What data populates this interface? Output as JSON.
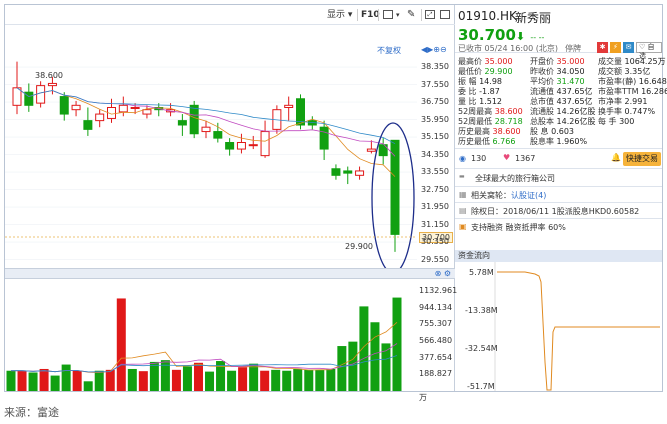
{
  "toolbar": {
    "display_label": "显示",
    "f10_label": "F10",
    "restore_label": "不复权"
  },
  "stock": {
    "code": "01910.HK",
    "name": "新秀丽",
    "price": "30.700",
    "arrow": "⬇",
    "change": "-- --",
    "status": "已收市 05/24 16:00 (北京)",
    "halt": "停牌",
    "watch_label": "自选"
  },
  "quote": {
    "rows": [
      [
        {
          "k": "最高价",
          "v": "35.000",
          "c": "red"
        },
        {
          "k": "开盘价",
          "v": "35.000",
          "c": "red"
        },
        {
          "k": "成交量",
          "v": "1064.25万",
          "c": "blk"
        }
      ],
      [
        {
          "k": "最低价",
          "v": "29.900",
          "c": "green"
        },
        {
          "k": "昨收价",
          "v": "34.050",
          "c": "blk"
        },
        {
          "k": "成交额",
          "v": "3.35亿",
          "c": "blk"
        }
      ],
      [
        {
          "k": "振 幅",
          "v": "14.98",
          "c": "blk"
        },
        {
          "k": "平均价",
          "v": "31.470",
          "c": "green"
        },
        {
          "k": "市盈率(静)",
          "v": "16.648",
          "c": "blk"
        }
      ],
      [
        {
          "k": "委 比",
          "v": "-1.87",
          "c": "blk"
        },
        {
          "k": "流通值",
          "v": "437.65亿",
          "c": "blk"
        },
        {
          "k": "市盈率TTM",
          "v": "16.286",
          "c": "blk"
        }
      ],
      [
        {
          "k": "量 比",
          "v": "1.512",
          "c": "blk"
        },
        {
          "k": "总市值",
          "v": "437.65亿",
          "c": "blk"
        },
        {
          "k": "市净率",
          "v": "2.991",
          "c": "blk"
        }
      ],
      [
        {
          "k": "52周最高",
          "v": "38.600",
          "c": "red"
        },
        {
          "k": "流通股",
          "v": "14.26亿股",
          "c": "blk"
        },
        {
          "k": "换手率",
          "v": "0.747%",
          "c": "blk"
        }
      ],
      [
        {
          "k": "52周最低",
          "v": "28.718",
          "c": "green"
        },
        {
          "k": "总股本",
          "v": "14.26亿股",
          "c": "blk"
        },
        {
          "k": "每 手",
          "v": "300",
          "c": "blk"
        }
      ],
      [
        {
          "k": "历史最高",
          "v": "38.600",
          "c": "red"
        },
        {
          "k": "股 息",
          "v": "0.603",
          "c": "blk"
        },
        {
          "k": "",
          "v": "",
          "c": "blk"
        }
      ],
      [
        {
          "k": "历史最低",
          "v": "6.766",
          "c": "green"
        },
        {
          "k": "股息率",
          "v": "1.960%",
          "c": "blk"
        },
        {
          "k": "",
          "v": "",
          "c": "blk"
        }
      ]
    ]
  },
  "social": {
    "views": "130",
    "likes": "1367",
    "trade_button": "快捷交易"
  },
  "info": {
    "company": "全球最大的旅行箱公司",
    "warrants": "相关窝轮：",
    "warrants_link": "认股证(4)",
    "dividend": "除权日：2018/06/11 1股派股息HKD0.60582",
    "margin": "支持融资 融资抵押率 60%"
  },
  "flow": {
    "title": "资金流向",
    "labels": [
      "5.78M",
      "-13.38M",
      "-32.54M",
      "-51.7M"
    ]
  },
  "axis": {
    "price_labels": [
      "38.350",
      "37.550",
      "36.750",
      "35.950",
      "35.150",
      "34.350",
      "33.550",
      "32.750",
      "31.950",
      "31.150",
      "30.350",
      "29.550"
    ],
    "vol_labels": [
      "1132.961",
      "944.134",
      "755.307",
      "566.480",
      "377.654",
      "188.827",
      "万"
    ],
    "high_label": "38.600",
    "low_label": "29.900",
    "current_label": "30.700"
  },
  "candles": [
    {
      "o": 36.6,
      "c": 37.4,
      "h": 38.6,
      "l": 36.2
    },
    {
      "o": 37.2,
      "c": 36.6,
      "h": 37.6,
      "l": 36.3
    },
    {
      "o": 36.7,
      "c": 37.5,
      "h": 37.7,
      "l": 36.5
    },
    {
      "o": 37.5,
      "c": 37.6,
      "h": 37.9,
      "l": 37.1
    },
    {
      "o": 37.0,
      "c": 36.2,
      "h": 37.2,
      "l": 35.9
    },
    {
      "o": 36.4,
      "c": 36.6,
      "h": 36.8,
      "l": 36.1
    },
    {
      "o": 35.9,
      "c": 35.5,
      "h": 36.5,
      "l": 35.2
    },
    {
      "o": 35.9,
      "c": 36.2,
      "h": 36.4,
      "l": 35.6
    },
    {
      "o": 36.0,
      "c": 36.5,
      "h": 36.9,
      "l": 35.8
    },
    {
      "o": 36.3,
      "c": 36.6,
      "h": 37.0,
      "l": 36.1
    },
    {
      "o": 36.5,
      "c": 36.5,
      "h": 36.7,
      "l": 36.2
    },
    {
      "o": 36.2,
      "c": 36.4,
      "h": 36.6,
      "l": 36.0
    },
    {
      "o": 36.5,
      "c": 36.4,
      "h": 36.7,
      "l": 36.1
    },
    {
      "o": 36.3,
      "c": 36.4,
      "h": 36.7,
      "l": 36.1
    },
    {
      "o": 35.9,
      "c": 35.7,
      "h": 36.2,
      "l": 35.2
    },
    {
      "o": 36.6,
      "c": 35.3,
      "h": 36.8,
      "l": 35.1
    },
    {
      "o": 35.4,
      "c": 35.6,
      "h": 35.9,
      "l": 35.1
    },
    {
      "o": 35.4,
      "c": 35.1,
      "h": 35.8,
      "l": 34.9
    },
    {
      "o": 34.9,
      "c": 34.6,
      "h": 35.1,
      "l": 34.3
    },
    {
      "o": 34.6,
      "c": 34.9,
      "h": 35.3,
      "l": 34.4
    },
    {
      "o": 34.8,
      "c": 34.8,
      "h": 35.2,
      "l": 34.6
    },
    {
      "o": 34.3,
      "c": 35.4,
      "h": 35.9,
      "l": 34.2
    },
    {
      "o": 35.5,
      "c": 36.4,
      "h": 36.6,
      "l": 35.3
    },
    {
      "o": 36.5,
      "c": 36.6,
      "h": 37.0,
      "l": 35.9
    },
    {
      "o": 36.9,
      "c": 35.7,
      "h": 37.1,
      "l": 35.5
    },
    {
      "o": 35.9,
      "c": 35.7,
      "h": 36.1,
      "l": 35.5
    },
    {
      "o": 35.6,
      "c": 34.6,
      "h": 35.9,
      "l": 34.1
    },
    {
      "o": 33.7,
      "c": 33.4,
      "h": 33.9,
      "l": 33.2
    },
    {
      "o": 33.6,
      "c": 33.5,
      "h": 33.8,
      "l": 33.0
    },
    {
      "o": 33.4,
      "c": 33.6,
      "h": 33.8,
      "l": 33.2
    },
    {
      "o": 34.5,
      "c": 34.6,
      "h": 35.0,
      "l": 34.4
    },
    {
      "o": 34.8,
      "c": 34.3,
      "h": 35.1,
      "l": 33.9
    },
    {
      "o": 35.0,
      "c": 30.7,
      "h": 35.0,
      "l": 29.9
    }
  ],
  "volumes": [
    {
      "v": 230,
      "up": false
    },
    {
      "v": 230,
      "up": true
    },
    {
      "v": 210,
      "up": false
    },
    {
      "v": 250,
      "up": true
    },
    {
      "v": 175,
      "up": false
    },
    {
      "v": 300,
      "up": false
    },
    {
      "v": 230,
      "up": true
    },
    {
      "v": 110,
      "up": false
    },
    {
      "v": 230,
      "up": false
    },
    {
      "v": 240,
      "up": true
    },
    {
      "v": 1050,
      "up": true
    },
    {
      "v": 250,
      "up": false
    },
    {
      "v": 225,
      "up": true
    },
    {
      "v": 330,
      "up": false
    },
    {
      "v": 350,
      "up": false
    },
    {
      "v": 240,
      "up": true
    },
    {
      "v": 280,
      "up": false
    },
    {
      "v": 320,
      "up": true
    },
    {
      "v": 220,
      "up": false
    },
    {
      "v": 340,
      "up": false
    },
    {
      "v": 230,
      "up": false
    },
    {
      "v": 270,
      "up": true
    },
    {
      "v": 310,
      "up": false
    },
    {
      "v": 230,
      "up": true
    },
    {
      "v": 240,
      "up": false
    },
    {
      "v": 230,
      "up": false
    },
    {
      "v": 250,
      "up": false
    },
    {
      "v": 240,
      "up": false
    },
    {
      "v": 240,
      "up": false
    },
    {
      "v": 250,
      "up": false
    },
    {
      "v": 510,
      "up": false
    },
    {
      "v": 560,
      "up": false
    },
    {
      "v": 960,
      "up": false
    },
    {
      "v": 780,
      "up": false
    },
    {
      "v": 540,
      "up": false
    },
    {
      "v": 1060,
      "up": false
    }
  ],
  "caption": "来源：富途",
  "colors": {
    "up": "#e01818",
    "down": "#11a011",
    "accent": "#2f6dc8"
  }
}
